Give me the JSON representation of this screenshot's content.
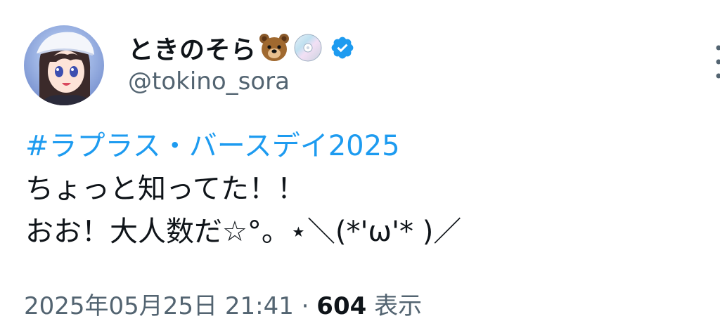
{
  "user": {
    "display_name": "ときのそら",
    "name_emojis": [
      "bear-face-icon",
      "cd-disc-icon"
    ],
    "verified": true,
    "handle": "@tokino_sora"
  },
  "tweet": {
    "hashtag": "#ラプラス・バースデイ2025",
    "line1": "ちょっと知ってた！！",
    "line2": "おお！大人数だ☆°。⋆＼(*'ω'* )／"
  },
  "meta": {
    "timestamp": "2025年05月25日 21:41",
    "separator": " · ",
    "views_count": "604",
    "views_label": " 表示"
  },
  "colors": {
    "link": "#1d9bf0",
    "text": "#0f1419",
    "secondary": "#536471",
    "verified_badge": "#1d9bf0"
  }
}
